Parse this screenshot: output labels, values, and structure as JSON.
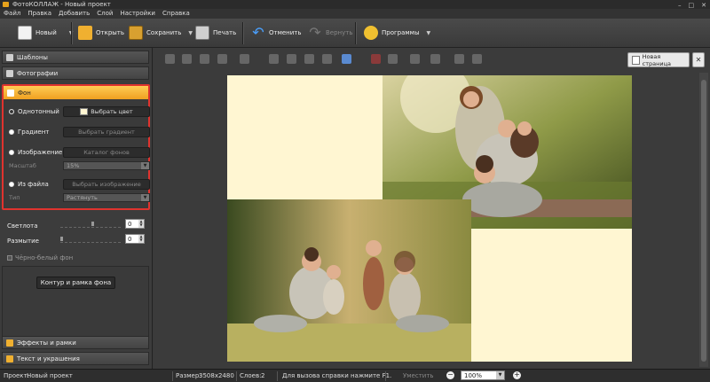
{
  "window": {
    "title": "ФотоКОЛЛАЖ - Новый проект"
  },
  "menu": [
    "Файл",
    "Правка",
    "Добавить",
    "Слой",
    "Настройки",
    "Справка"
  ],
  "toolbar": {
    "new": "Новый",
    "open": "Открыть",
    "save": "Сохранить",
    "print": "Печать",
    "undo": "Отменить",
    "redo": "Вернуть",
    "programs": "Программы"
  },
  "sidebar": {
    "templates": "Шаблоны",
    "photos": "Фотографии",
    "background": "Фон",
    "effects": "Эффекты и рамки",
    "text": "Текст и украшения"
  },
  "background_panel": {
    "solid_label": "Однотонный",
    "choose_color": "Выбрать цвет",
    "gradient_label": "Градиент",
    "choose_gradient": "Выбрать градиент",
    "image_label": "Изображение",
    "catalog": "Каталог фонов",
    "scale_label": "Масштаб",
    "scale_value": "15%",
    "file_label": "Из файла",
    "choose_image": "Выбрать изображение",
    "type_label": "Тип",
    "type_value": "Растянуть",
    "selected": "solid",
    "swatch_color": "#fff6d2"
  },
  "adjust": {
    "brightness_label": "Светлота",
    "brightness_value": "0",
    "blur_label": "Размытие",
    "blur_value": "0",
    "bw_label": "Чёрно-белый фон",
    "frame_button": "Контур и рамка фона"
  },
  "canvas": {
    "new_page": "Новая страница",
    "background_color": "#fff6d2"
  },
  "status": {
    "project_label": "Проект:",
    "project_name": "Новый проект",
    "size_label": "Размер:",
    "size_value": "3508x2480",
    "layers_label": "Слоев:",
    "layers_value": "2",
    "help": "Для вызова справки нажмите F1.",
    "fit": "Уместить",
    "zoom": "100%"
  },
  "colors": {
    "accent": "#f0a020",
    "highlight_border": "#e0332e"
  }
}
